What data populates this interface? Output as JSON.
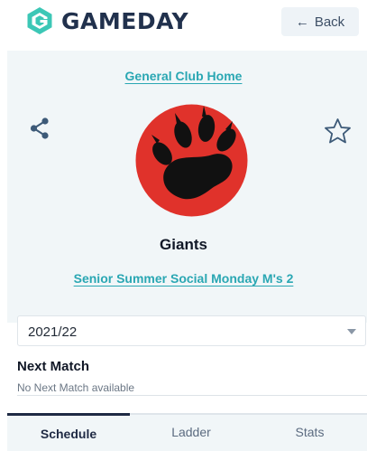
{
  "header": {
    "brand": "GAMEDAY",
    "back_label": "Back",
    "back_arrow": "←"
  },
  "club": {
    "home_link": "General Club Home",
    "team_name": "Giants",
    "competition_link": "Senior Summer Social Monday M's 2"
  },
  "season_select": {
    "selected": "2021/22"
  },
  "next_match": {
    "title": "Next Match",
    "empty_text": "No Next Match available"
  },
  "tabs": [
    {
      "label": "Schedule",
      "active": true
    },
    {
      "label": "Ladder",
      "active": false
    },
    {
      "label": "Stats",
      "active": false
    }
  ],
  "colors": {
    "brand_teal": "#2aa7b3",
    "logo_teal": "#3cc7b6",
    "navy": "#21314d",
    "badge_red": "#e0322b",
    "panel_bg": "#f1f6f8"
  }
}
